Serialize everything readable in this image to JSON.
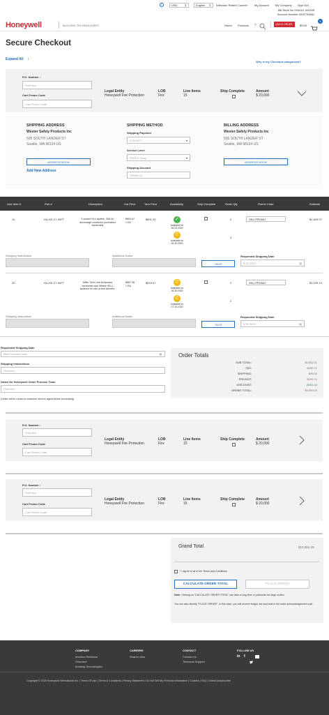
{
  "topbar": {
    "currency": "USD",
    "language": "English",
    "welcome": "Welcome Robert Counter",
    "my_account": "My Account",
    "my_company": "My Company",
    "sign_out": "Sign Out",
    "bill_to": "Bill Store No 000419, 000039",
    "account_number": "Account Number 0001704661"
  },
  "header": {
    "logo": "Honeywell",
    "division": "BUILDING TECHNOLOGIES",
    "nav_home": "Home",
    "nav_products": "Products",
    "quick_order": "QUICK ORDER",
    "cart_total": "$0.00",
    "cart_count": "3"
  },
  "page": {
    "title": "Secure Checkout",
    "expand_all": "Expand All",
    "why_link": "Why is my Checkout categorized?"
  },
  "group_header": {
    "po_label": "P.O. Number",
    "po_placeholder": "Print text",
    "promo_label": "Cart Promo Code",
    "promo_placeholder": "Cart Promo Code",
    "legal_label": "Legal Entity",
    "legal_value": "Honeywell Fire Protection",
    "lob_label": "LOB",
    "lob_value": "Fire",
    "items_label": "Line Items",
    "items_value": "15",
    "ship_label": "Ship Complete",
    "amount_label": "Amount",
    "amount_value": "$ 20,000"
  },
  "shipping": {
    "heading": "SHIPPING ADDRESS",
    "company": "Wester Safety Products Inc",
    "street": "505 SOUTH LANDER ST",
    "city": "Seattle, WA   98134   US",
    "address_book": "ADDRESS BOOK",
    "add_new": "Add New Address"
  },
  "method": {
    "heading": "SHIPPING METHOD",
    "payment_label": "Shipping Payment",
    "payment_value": "COLLECT",
    "level_label": "Service Level",
    "level_value": "FEDEX 2Day",
    "account_label": "Shipping Account",
    "account_value": "FE098710"
  },
  "billing": {
    "heading": "BILLING ADDRESS",
    "company": "Wester Safety Products Inc",
    "street": "505 SOUTH LANDER ST",
    "city": "Seattle, WA   98134   US",
    "address_book": "ADDRESS BOOK"
  },
  "table": {
    "headers": [
      "Line Item #",
      "Part #",
      "Description",
      "List Price",
      "Your Price",
      "Availability",
      "Ship Complete",
      "Order Qty",
      "Promo Code",
      "Subtotal"
    ]
  },
  "lines": [
    {
      "no": "10",
      "part": "HLLKE-27-90FT",
      "desc": "2 worker HLL system, 30ft kit, anchorage connector purchased separately",
      "list": "$993.67\n1 EA",
      "your": "$801.29",
      "avail1": "Available on\n06.23.2020",
      "avail2": "Available on\n06.30.2020",
      "qty": "2",
      "qty2": "3",
      "promo": "SKU PROMO",
      "subtotal": "$1,603.07",
      "ship_instr": "Shipping Instructions",
      "notes": "Additional Notes",
      "tags": "TAGS",
      "req_label": "Requested Shipping Date",
      "req_value": "6.23.2020"
    },
    {
      "no": "20",
      "part": "HLLKE-27-90FT",
      "desc": "Miller Tech Line temporary horizontal rope lifeline (HLL) systems for one or two workers.",
      "list": "$887.06\n1 EA",
      "your": "$524.57",
      "avail1": "Available on\n06.30.2020",
      "avail2": "Available on\n07.15.2020",
      "qty": "2",
      "qty2": "2",
      "promo": "SKU PROMO",
      "subtotal": "$1,049.14",
      "ship_instr": "Shipping Instructions",
      "notes": "Additional Notes",
      "tags": "TAGS",
      "req_label": "Requested Shipping Date",
      "req_value": "6.30.2020"
    }
  ],
  "order_fields": {
    "req_label": "Requested Shipping Date",
    "req_placeholder": "Best Possible Date",
    "instr_label": "Shipping Instructions",
    "instr_placeholder": "Print text",
    "notes_label": "Notes for Honeywell Order Process Team",
    "notes_placeholder": "Print text",
    "notice": "(Order will be routed to customer service agent before processing)"
  },
  "totals": {
    "heading": "Order Totals",
    "rows": [
      {
        "label": "SUB TOTAL:",
        "value": "$2,652.01"
      },
      {
        "label": "TAX:",
        "value": "$199.71"
      },
      {
        "label": "SHIPPING:",
        "value": "$99.00"
      },
      {
        "label": "FREIGHT:",
        "value": "$199.71"
      },
      {
        "label": "DISCOUNT:",
        "value": "-$351.43"
      },
      {
        "label": "ORDER TOTAL:",
        "value": "$3,000.00"
      }
    ]
  },
  "grand": {
    "heading": "Grand Total",
    "value": "$10,054.29",
    "terms": "* I agree to all of the Terms and Conditions",
    "calc": "CALCULATE ORDER TOTAL",
    "place": "PLACE ORDER",
    "note_bold": "Note:",
    "note1": "Clicking on \"CALCULATE ORDER TOTAL\" can take a long time, in particular for large orders.",
    "note2": "You can also directly \"PLACE ORDER\". In this case, you will receive freight, tax and total in the order acknowledgement mail."
  },
  "footer": {
    "company": "COMPANY",
    "company_links": [
      "Investor Relations",
      "Overview",
      "Building Technologies"
    ],
    "careers": "CAREERS",
    "careers_links": [
      "Search Jobs"
    ],
    "contact": "CONTACT",
    "contact_links": [
      "Contact Us",
      "Technical Support"
    ],
    "follow": "FOLLOW US",
    "copyright": "Copyright © 2020 Honeywell International Inc.",
    "links": [
      "Terms Of Use",
      "Terms & Conditions",
      "Privacy Statement",
      "Do Not Sell My Personal Information",
      "Cookies",
      "FAQ",
      "Global Unsubscribe"
    ]
  }
}
